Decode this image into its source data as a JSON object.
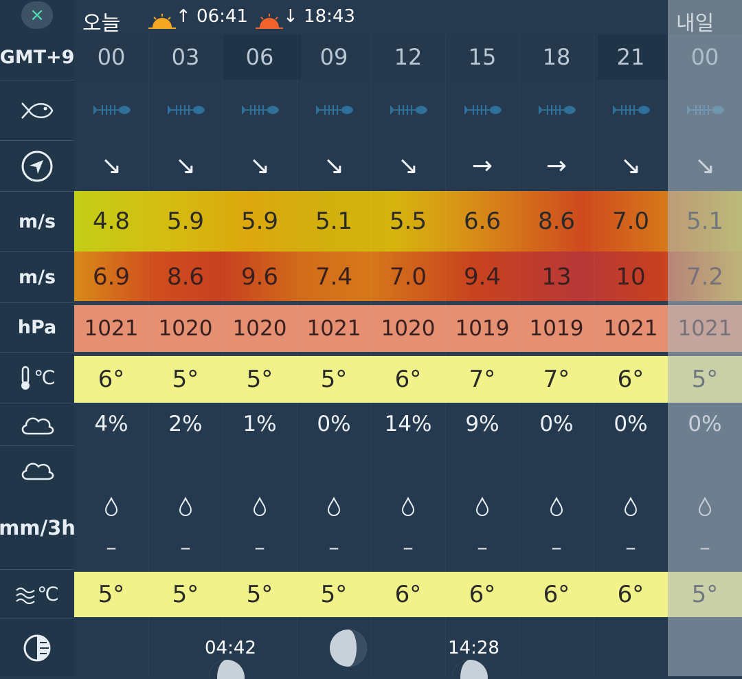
{
  "header": {
    "close_icon": "×",
    "today_label": "오늘",
    "sunrise_time": "↑ 06:41",
    "sunset_time": "↓ 18:43",
    "tomorrow_label": "내일"
  },
  "row_labels": {
    "timezone": "GMT+9",
    "fish_icon": "fish-icon",
    "direction_icon": "compass-icon",
    "wind_unit": "m/s",
    "gust_unit": "m/s",
    "pressure_unit": "hPa",
    "temp_unit": "℃",
    "cloud_icon": "cloud-icon",
    "rain_unit": "mm/3h",
    "sea_temp_unit": "℃",
    "moon_icon": "moon-icon"
  },
  "columns": [
    {
      "hour": "00",
      "wind": "4.8",
      "gust": "6.9",
      "pressure": "1021",
      "temp": "6°",
      "cloud": "4%",
      "rain": "–",
      "sea": "5°",
      "dir": "↘"
    },
    {
      "hour": "03",
      "wind": "5.9",
      "gust": "8.6",
      "pressure": "1020",
      "temp": "5°",
      "cloud": "2%",
      "rain": "–",
      "sea": "5°",
      "dir": "↘"
    },
    {
      "hour": "06",
      "wind": "5.9",
      "gust": "9.6",
      "pressure": "1020",
      "temp": "5°",
      "cloud": "1%",
      "rain": "–",
      "sea": "5°",
      "dir": "↘"
    },
    {
      "hour": "09",
      "wind": "5.1",
      "gust": "7.4",
      "pressure": "1021",
      "temp": "5°",
      "cloud": "0%",
      "rain": "–",
      "sea": "5°",
      "dir": "↘"
    },
    {
      "hour": "12",
      "wind": "5.5",
      "gust": "7.0",
      "pressure": "1020",
      "temp": "6°",
      "cloud": "14%",
      "rain": "–",
      "sea": "6°",
      "dir": "↘"
    },
    {
      "hour": "15",
      "wind": "6.6",
      "gust": "9.4",
      "pressure": "1019",
      "temp": "7°",
      "cloud": "9%",
      "rain": "–",
      "sea": "6°",
      "dir": "→"
    },
    {
      "hour": "18",
      "wind": "8.6",
      "gust": "13",
      "pressure": "1019",
      "temp": "7°",
      "cloud": "0%",
      "rain": "–",
      "sea": "6°",
      "dir": "→"
    },
    {
      "hour": "21",
      "wind": "7.0",
      "gust": "10",
      "pressure": "1021",
      "temp": "6°",
      "cloud": "0%",
      "rain": "–",
      "sea": "6°",
      "dir": "↘"
    },
    {
      "hour": "00",
      "wind": "5.1",
      "gust": "7.2",
      "pressure": "1021",
      "temp": "5°",
      "cloud": "0%",
      "rain": "–",
      "sea": "5°",
      "dir": "↘"
    }
  ],
  "moon": {
    "moonrise_time": "04:42",
    "moonset_time": "14:28"
  },
  "colors": {
    "background": "#253A4E",
    "accent": "#52E0B6",
    "temp_band": "#F2F28A",
    "pressure_band": "#E59072"
  }
}
